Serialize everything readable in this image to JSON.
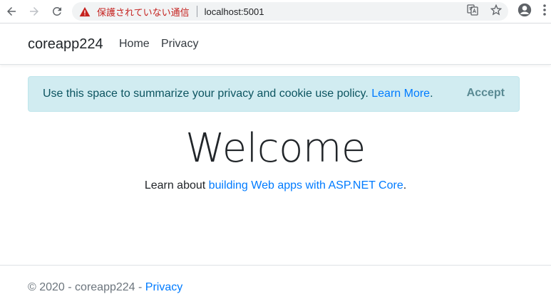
{
  "browser": {
    "security_warning": "保護されていない通信",
    "url": "localhost:5001",
    "icons": [
      "back-icon",
      "forward-icon",
      "reload-icon",
      "warning-icon",
      "translate-icon",
      "bookmark-star-icon",
      "profile-icon",
      "menu-icon"
    ]
  },
  "navbar": {
    "brand": "coreapp224",
    "links": [
      {
        "label": "Home"
      },
      {
        "label": "Privacy"
      }
    ]
  },
  "cookie_alert": {
    "message": "Use this space to summarize your privacy and cookie use policy.",
    "learn_more": "Learn More",
    "period": ".",
    "accept_label": "Accept",
    "colors": {
      "background": "#d1ecf1",
      "text": "#0c5460",
      "link": "#007bff"
    }
  },
  "main": {
    "title": "Welcome",
    "learn_prefix": "Learn about ",
    "learn_link": "building Web apps with ASP.NET Core",
    "learn_suffix": "."
  },
  "footer": {
    "copyright": "© 2020 - coreapp224 - ",
    "privacy_link": "Privacy"
  }
}
